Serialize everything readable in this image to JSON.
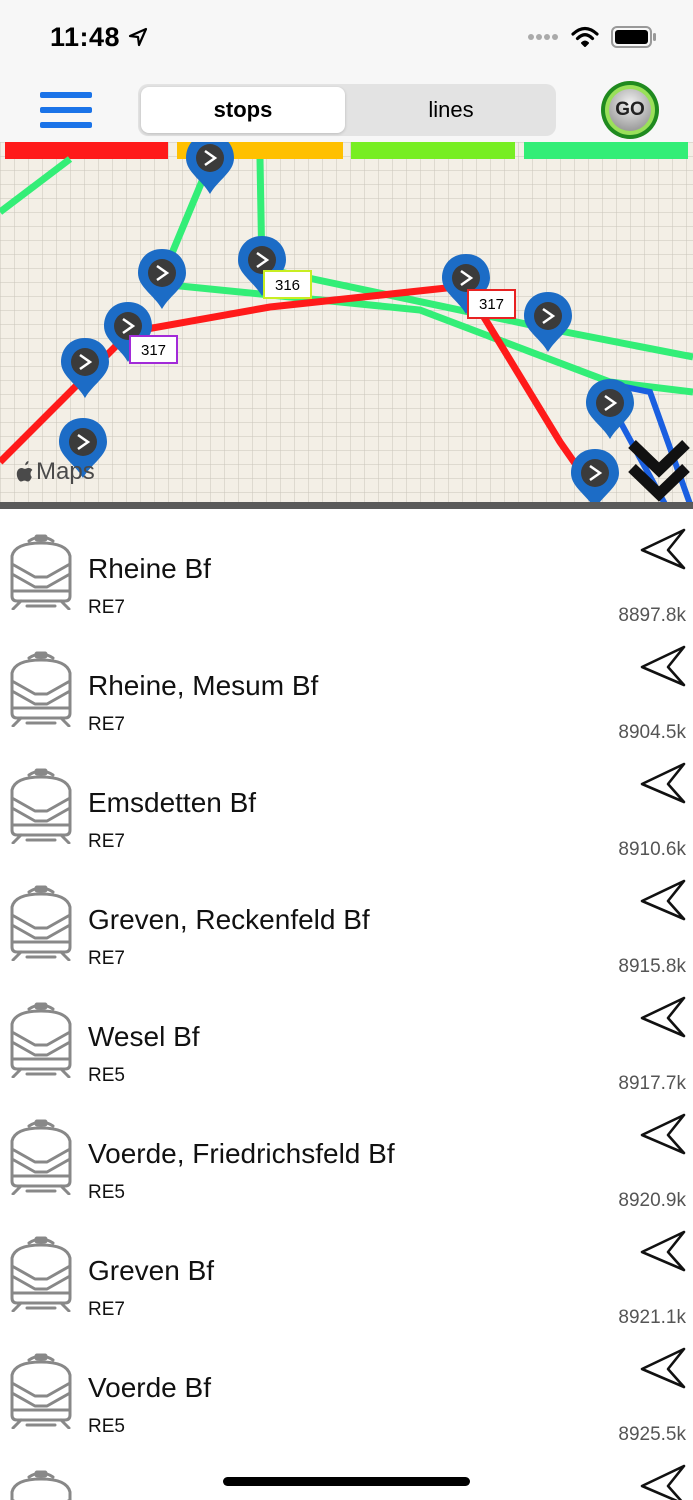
{
  "status_bar": {
    "time": "11:48"
  },
  "nav": {
    "menu_icon": "hamburger-menu-icon",
    "tabs": [
      {
        "label": "stops",
        "active": true
      },
      {
        "label": "lines",
        "active": false
      }
    ],
    "go_label": "GO"
  },
  "map": {
    "attribution": "Maps",
    "line_labels": [
      "316",
      "317",
      "317"
    ],
    "colors": {
      "red": "#ff1a1a",
      "green": "#33ee77",
      "blue": "#1a5fe0",
      "yellow": "#ffc000",
      "lime": "#77ee22"
    }
  },
  "stops": [
    {
      "name": "Rheine Bf",
      "line": "RE7",
      "distance": "8897.8k"
    },
    {
      "name": "Rheine, Mesum Bf",
      "line": "RE7",
      "distance": "8904.5k"
    },
    {
      "name": "Emsdetten Bf",
      "line": "RE7",
      "distance": "8910.6k"
    },
    {
      "name": "Greven, Reckenfeld Bf",
      "line": "RE7",
      "distance": "8915.8k"
    },
    {
      "name": "Wesel Bf",
      "line": "RE5",
      "distance": "8917.7k"
    },
    {
      "name": "Voerde, Friedrichsfeld Bf",
      "line": "RE5",
      "distance": "8920.9k"
    },
    {
      "name": "Greven Bf",
      "line": "RE7",
      "distance": "8921.1k"
    },
    {
      "name": "Voerde Bf",
      "line": "RE5",
      "distance": "8925.5k"
    }
  ]
}
